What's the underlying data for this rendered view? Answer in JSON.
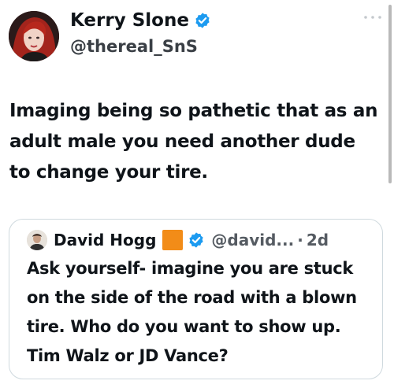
{
  "tweet": {
    "author_name": "Kerry Slone",
    "author_handle": "@thereal_SnS",
    "text": "Imaging being so pathetic that as an adult male you need another dude to change your tire."
  },
  "quote": {
    "author_name": "David Hogg",
    "author_handle": "@david...",
    "separator": "·",
    "time": "2d",
    "text": "Ask yourself- imagine you are stuck on the side of the road with a blown tire. Who do you want to show up. Tim Walz or JD Vance?"
  },
  "icons": {
    "verified": "verified-badge-icon",
    "more": "more-options-icon",
    "emoji": "orange-square-emoji"
  },
  "colors": {
    "verified_blue": "#1d9bf0",
    "text": "#0f1419",
    "handle_gray": "#555b62",
    "border": "#cfd9de",
    "emoji_orange": "#f28c18"
  }
}
